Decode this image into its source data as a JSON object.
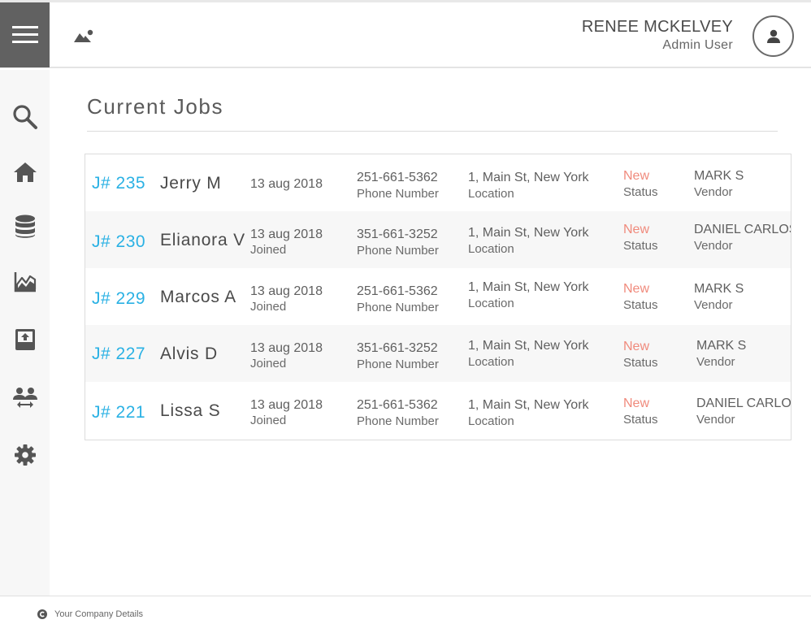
{
  "header": {
    "user_name": "RENEE MCKELVEY",
    "user_role": "Admin User"
  },
  "icons": {
    "menu": "hamburger-icon",
    "logo": "mountain-sun-icon",
    "avatar": "user-icon"
  },
  "sidebar": {
    "items": [
      {
        "name": "search",
        "icon": "search-icon"
      },
      {
        "name": "home",
        "icon": "home-icon"
      },
      {
        "name": "database",
        "icon": "database-icon"
      },
      {
        "name": "analytics",
        "icon": "area-chart-icon"
      },
      {
        "name": "upload",
        "icon": "upload-icon"
      },
      {
        "name": "users",
        "icon": "users-icon"
      },
      {
        "name": "settings",
        "icon": "gear-icon"
      }
    ]
  },
  "page": {
    "title": "Current Jobs"
  },
  "jobs": [
    {
      "id": "J# 235",
      "name": "Jerry M",
      "date": "13 aug 2018",
      "date_label": "",
      "phone": "251-661-5362",
      "phone_label": "Phone Number",
      "location": "1, Main St, New York",
      "location_label": "Location",
      "status": "New",
      "status_label": "Status",
      "vendor": "MARK S",
      "vendor_label": "Vendor"
    },
    {
      "id": "J# 230",
      "name": "Elianora V",
      "date": "13 aug 2018",
      "date_label": "Joined",
      "phone": "351-661-3252",
      "phone_label": "Phone Number",
      "location": "1, Main St, New York",
      "location_label": "Location",
      "status": "New",
      "status_label": "Status",
      "vendor": "DANIEL CARLOS",
      "vendor_label": "Vendor"
    },
    {
      "id": "J# 229",
      "name": "Marcos A",
      "date": "13 aug 2018",
      "date_label": "Joined",
      "phone": "251-661-5362",
      "phone_label": "Phone Number",
      "location": "1, Main St, New York",
      "location_label": "Location",
      "status": "New",
      "status_label": "Status",
      "vendor": "MARK S",
      "vendor_label": "Vendor"
    },
    {
      "id": "J# 227",
      "name": "Alvis D",
      "date": "13 aug 2018",
      "date_label": "Joined",
      "phone": "351-661-3252",
      "phone_label": "Phone Number",
      "location": "1, Main St, New York",
      "location_label": "Location",
      "status": "New",
      "status_label": "Status",
      "vendor": "MARK S",
      "vendor_label": "Vendor"
    },
    {
      "id": "J# 221",
      "name": "Lissa S",
      "date": "13 aug 2018",
      "date_label": "Joined",
      "phone": "251-661-5362",
      "phone_label": "Phone Number",
      "location": "1, Main St, New York",
      "location_label": "Location",
      "status": "New",
      "status_label": "Status",
      "vendor": "DANIEL CARLOS",
      "vendor_label": "Vendor"
    }
  ],
  "footer": {
    "text": "Your Company Details",
    "icon": "copyright-icon"
  },
  "colors": {
    "accent": "#2ab1e4",
    "status_new": "#f08a7c",
    "menu_bg": "#616161",
    "sidebar_bg": "#f7f7f7"
  }
}
